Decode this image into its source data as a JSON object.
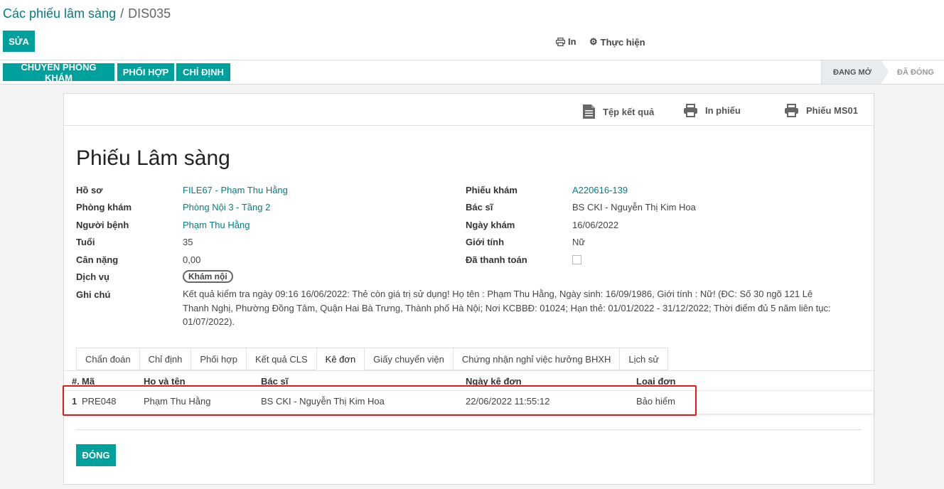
{
  "breadcrumb": {
    "parent": "Các phiếu lâm sàng",
    "separator": "/",
    "current": "DIS035"
  },
  "toolbar": {
    "edit": "SỬA",
    "print": "In",
    "action": "Thực hiện"
  },
  "header_buttons": {
    "transfer": "CHUYỂN PHÒNG KHÁM",
    "coordinate": "PHỐI HỢP",
    "order": "CHỈ ĐỊNH"
  },
  "status": {
    "open": "ĐANG MỞ",
    "closed": "ĐÃ ĐÓNG"
  },
  "sheet_buttons": {
    "result_file": "Tệp kết quả",
    "print_sheet": "In phiếu",
    "print_ms01": "Phiếu MS01"
  },
  "form": {
    "title": "Phiếu Lâm sàng",
    "left": {
      "record_label": "Hồ sơ",
      "record_value": "FILE67 - Phạm Thu Hằng",
      "clinic_label": "Phòng khám",
      "clinic_value": "Phòng Nội 3 - Tầng 2",
      "patient_label": "Người bệnh",
      "patient_value": "Phạm Thu Hằng",
      "age_label": "Tuổi",
      "age_value": "35",
      "weight_label": "Cân nặng",
      "weight_value": "0,00",
      "service_label": "Dịch vụ",
      "service_value": "Khám nội",
      "note_label": "Ghi chú",
      "note_value": "Kết quả kiểm tra ngày 09:16 16/06/2022: Thẻ còn giá trị sử dụng! Họ tên : Phạm Thu Hằng, Ngày sinh: 16/09/1986, Giới tính : Nữ! (ĐC: Số 30 ngõ 121 Lê Thanh Nghị, Phường Đồng Tâm, Quận Hai Bà Trưng, Thành phố Hà Nội; Nơi KCBBĐ: 01024; Hạn thẻ: 01/01/2022 - 31/12/2022; Thời điểm đủ 5 năm liên tục: 01/07/2022)."
    },
    "right": {
      "exam_label": "Phiếu khám",
      "exam_value": "A220616-139",
      "doctor_label": "Bác sĩ",
      "doctor_value": "BS CKI - Nguyễn Thị Kim Hoa",
      "date_label": "Ngày khám",
      "date_value": "16/06/2022",
      "gender_label": "Giới tính",
      "gender_value": "Nữ",
      "paid_label": "Đã thanh toán"
    }
  },
  "tabs": [
    "Chẩn đoán",
    "Chỉ định",
    "Phối hợp",
    "Kết quả CLS",
    "Kê đơn",
    "Giấy chuyển viện",
    "Chứng nhận nghỉ việc hưởng BHXH",
    "Lịch sử"
  ],
  "table": {
    "headers": {
      "num": "#.",
      "code": "Mã",
      "name": "Họ và tên",
      "doctor": "Bác sĩ",
      "date": "Ngày kê đơn",
      "type": "Loại đơn"
    },
    "rows": [
      {
        "num": "1",
        "code": "PRE048",
        "name": "Phạm Thu Hằng",
        "doctor": "BS CKI - Nguyễn Thị Kim Hoa",
        "date": "22/06/2022 11:55:12",
        "type": "Bảo hiểm"
      }
    ]
  },
  "footer": {
    "close": "ĐÓNG"
  },
  "colors": {
    "primary": "#00a09d",
    "link": "#017e84",
    "highlight": "#e21a1a"
  }
}
